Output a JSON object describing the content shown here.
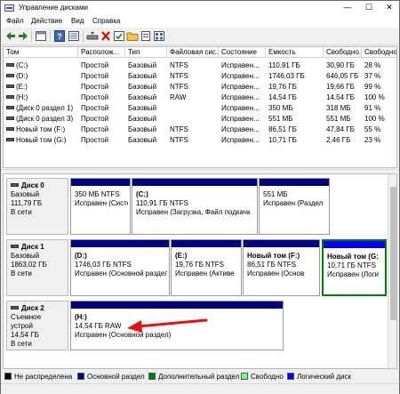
{
  "window": {
    "title": "Управление дисками",
    "min_symbol": "—",
    "max_symbol": "☐",
    "close_symbol": "✕"
  },
  "menu": [
    "Файл",
    "Действие",
    "Вид",
    "Справка"
  ],
  "toolbar_icons": [
    "back-arrow-icon",
    "forward-arrow-icon",
    "console-tree-icon",
    "help-icon",
    "properties-icon",
    "connect-drive-icon",
    "delete-icon",
    "check-icon",
    "new-folder-icon",
    "open-icon",
    "view-icon"
  ],
  "colors": {
    "unallocated": "#000000",
    "primary": "#000080",
    "extended": "#008000",
    "free": "#7cfc7c",
    "logical": "#0000ff",
    "selected_border": "#008000"
  },
  "volume_table": {
    "headers": [
      "Том",
      "Располож...",
      "Тип",
      "Файловая сис...",
      "Состояние",
      "Емкость",
      "Свободно...",
      "Свободно %"
    ],
    "rows": [
      [
        "(C:)",
        "Простой",
        "Базовый",
        "NTFS",
        "Исправен...",
        "110,91 ГБ",
        "30,90 ГБ",
        "28 %"
      ],
      [
        "(D:)",
        "Простой",
        "Базовый",
        "NTFS",
        "Исправен...",
        "1746,03 ГБ",
        "646,05 ГБ",
        "37 %"
      ],
      [
        "(E:)",
        "Простой",
        "Базовый",
        "NTFS",
        "Исправен...",
        "19,76 ГБ",
        "19,66 ГБ",
        "99 %"
      ],
      [
        "(H:)",
        "Простой",
        "Базовый",
        "RAW",
        "Исправен...",
        "14,54 ГБ",
        "14,54 ГБ",
        "100 %"
      ],
      [
        "(Диск 0 раздел 1)",
        "Простой",
        "Базовый",
        "",
        "Исправен...",
        "350 МБ",
        "318 МБ",
        "91 %"
      ],
      [
        "(Диск 0 раздел 3)",
        "Простой",
        "Базовый",
        "",
        "Исправен...",
        "551 МБ",
        "551 МБ",
        "100 %"
      ],
      [
        "Новый том (F:)",
        "Простой",
        "Базовый",
        "NTFS",
        "Исправен...",
        "86,51 ГБ",
        "47,84 ГБ",
        "55 %"
      ],
      [
        "Новый том (G:)",
        "Простой",
        "Базовый",
        "NTFS",
        "Исправен...",
        "10,71 ГБ",
        "2,46 ГБ",
        "23 %"
      ]
    ]
  },
  "disks": [
    {
      "name": "Диск 0",
      "type": "Базовый",
      "size": "111,79 ГБ",
      "status": "В сети",
      "partitions": [
        {
          "title": "",
          "line1": "350 МБ NTFS",
          "line2": "Исправен (Систе",
          "kind": "primary"
        },
        {
          "title": "(C:)",
          "line1": "110,91 ГБ NTFS",
          "line2": "Исправен (Загрузка, Файл подкачк",
          "kind": "primary"
        },
        {
          "title": "",
          "line1": "551 МБ",
          "line2": "Исправен (Раздел",
          "kind": "primary"
        }
      ]
    },
    {
      "name": "Диск 1",
      "type": "Базовый",
      "size": "1863,02 ГБ",
      "status": "В сети",
      "partitions": [
        {
          "title": "(D:)",
          "line1": "1746,03 ГБ NTFS",
          "line2": "Исправен (Основной раздел",
          "kind": "primary"
        },
        {
          "title": "(E:)",
          "line1": "19,76 ГБ NTFS",
          "line2": "Исправен (Активе",
          "kind": "primary"
        },
        {
          "title": "Новый том  (F:)",
          "line1": "86,51 ГБ NTFS",
          "line2": "Исправен (Основ",
          "kind": "primary"
        },
        {
          "title": "Новый том  (G:",
          "line1": "10,71 ГБ NTFS",
          "line2": "Исправен (Логи",
          "kind": "logical"
        }
      ]
    },
    {
      "name": "Диск 2",
      "type": "Съемное устрой",
      "size": "14,54 ГБ",
      "status": "В сети",
      "partitions": [
        {
          "title": "(H:)",
          "line1": "14,54 ГБ RAW",
          "line2": "Исправен (Основной раздел)",
          "kind": "primary"
        }
      ]
    }
  ],
  "legend": [
    {
      "label": "Не распределена",
      "color": "#000000"
    },
    {
      "label": "Основной раздел",
      "color": "#000080"
    },
    {
      "label": "Дополнительный раздел",
      "color": "#008000"
    },
    {
      "label": "Свободно",
      "color": "#7cfc7c"
    },
    {
      "label": "Логический диск",
      "color": "#0000ff"
    }
  ]
}
